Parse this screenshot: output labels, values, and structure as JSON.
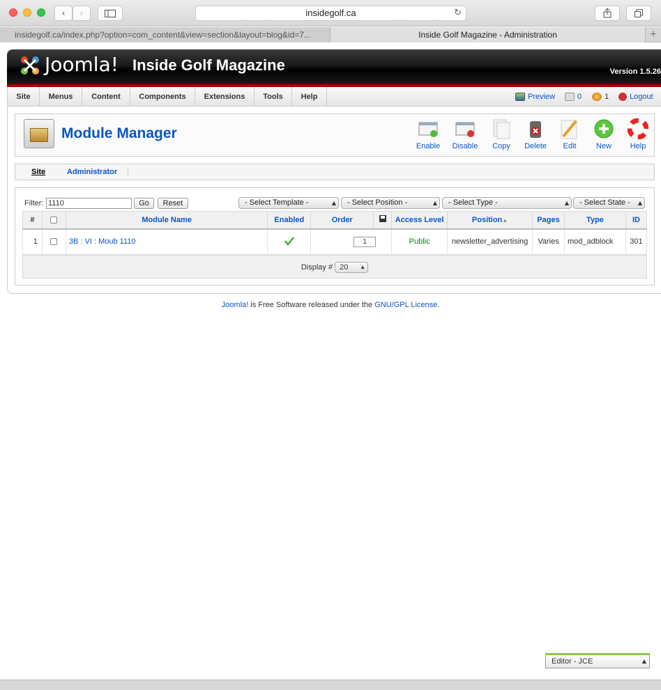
{
  "browser": {
    "url": "insidegolf.ca",
    "tabs": [
      {
        "label": "insidegolf.ca/index.php?option=com_content&view=section&layout=blog&id=7..."
      },
      {
        "label": "Inside Golf Magazine - Administration"
      }
    ]
  },
  "header": {
    "logo_text": "Joomla!",
    "site_title": "Inside Golf Magazine",
    "version": "Version 1.5.26"
  },
  "menu": {
    "items": [
      "Site",
      "Menus",
      "Content",
      "Components",
      "Extensions",
      "Tools",
      "Help"
    ],
    "preview": "Preview",
    "messages": "0",
    "users": "1",
    "logout": "Logout"
  },
  "toolbar": {
    "title": "Module Manager",
    "buttons": [
      "Enable",
      "Disable",
      "Copy",
      "Delete",
      "Edit",
      "New",
      "Help"
    ]
  },
  "submenu": {
    "items": [
      "Site",
      "Administrator"
    ]
  },
  "filter": {
    "label": "Filter:",
    "value": "1110",
    "go": "Go",
    "reset": "Reset",
    "selects": [
      "- Select Template -",
      "- Select Position -",
      "- Select Type -",
      "- Select State -"
    ]
  },
  "table": {
    "columns": [
      "#",
      "",
      "Module Name",
      "Enabled",
      "Order",
      "",
      "Access Level",
      "Position",
      "Pages",
      "Type",
      "ID"
    ],
    "rows": [
      {
        "num": "1",
        "name": "3B : VI : Moub 1110",
        "order": "1",
        "access": "Public",
        "position": "newsletter_advertising",
        "pages": "Varies",
        "type": "mod_adblock",
        "id": "301"
      }
    ],
    "display_label": "Display #",
    "display_value": "20"
  },
  "footer": {
    "joomla": "Joomla!",
    "text": " is Free Software released under the ",
    "license": "GNU/GPL License",
    "end": "."
  },
  "editor_select": "Editor - JCE",
  "colors": {
    "accent": "#0b55c4",
    "header_red": "#aa0000",
    "public_green": "#008000"
  }
}
